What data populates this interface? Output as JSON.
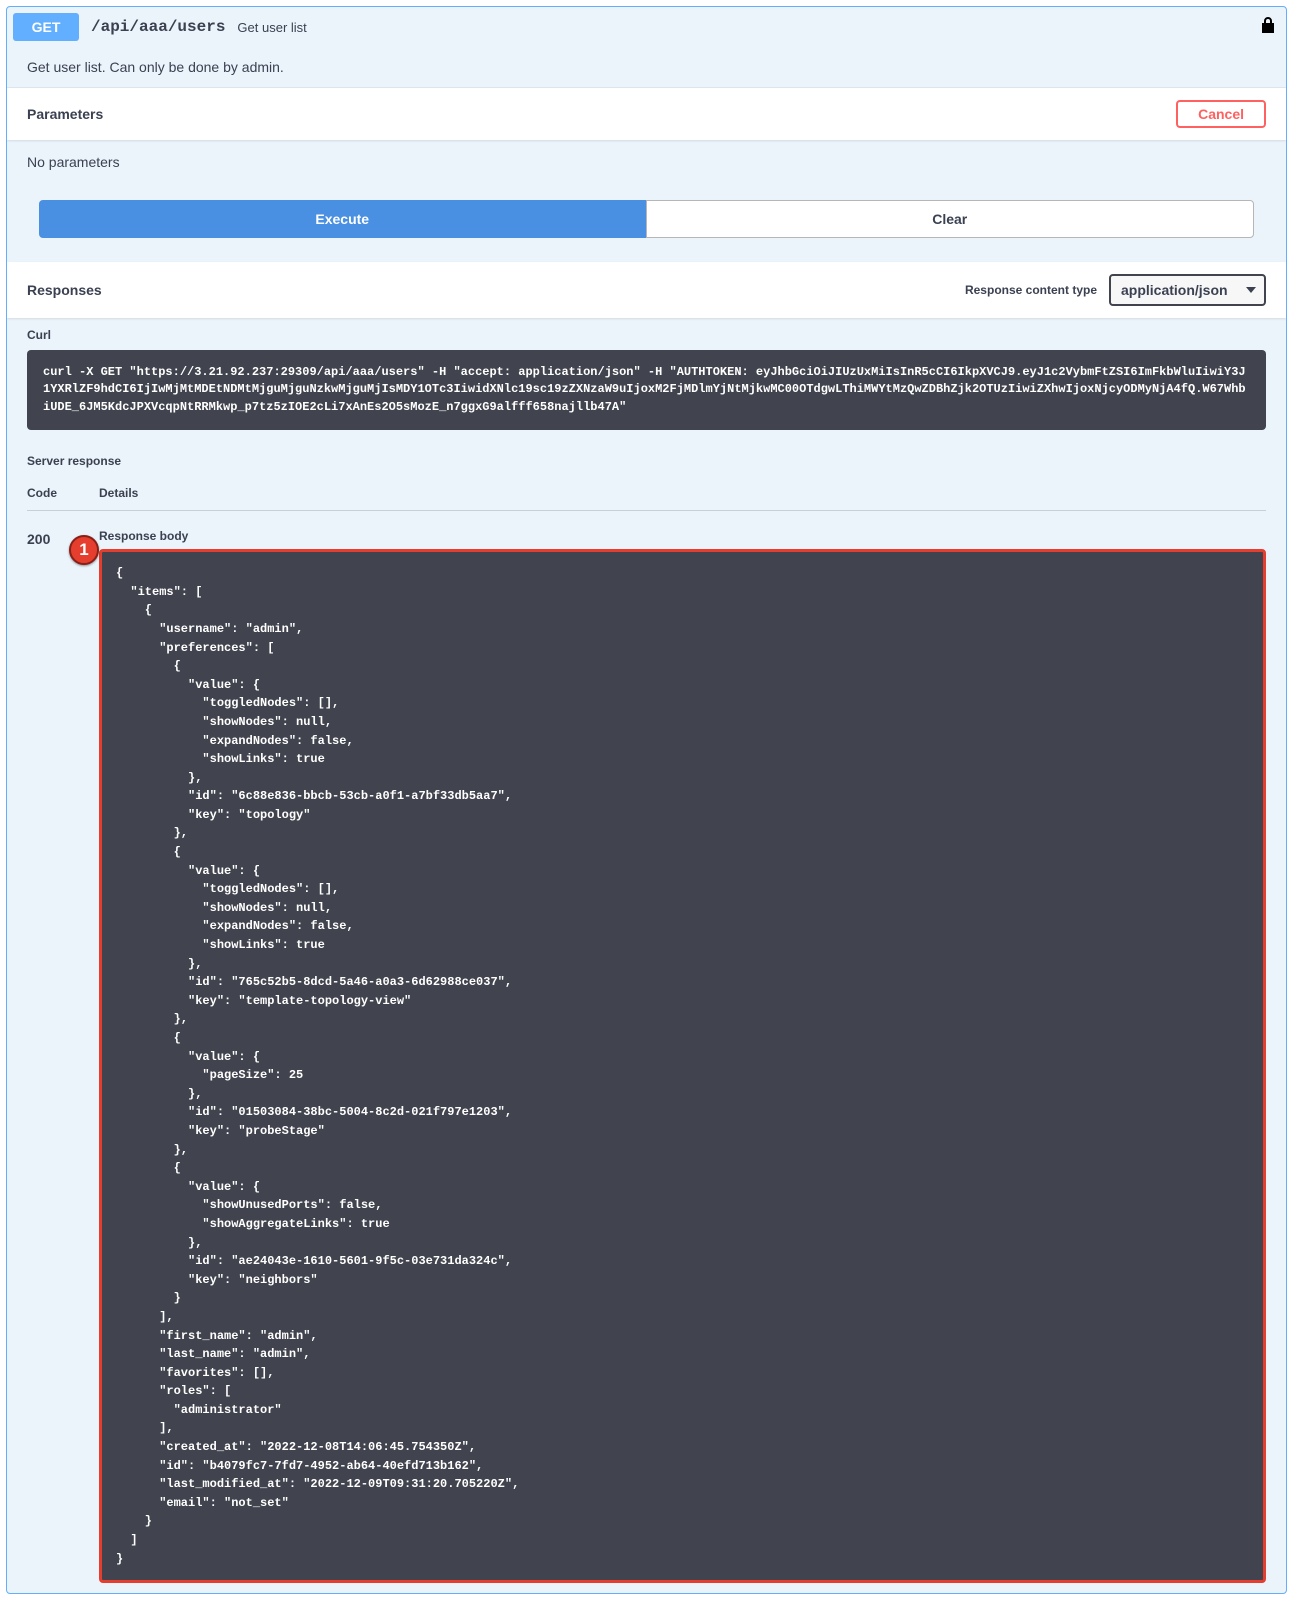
{
  "endpoint": {
    "method": "GET",
    "path": "/api/aaa/users",
    "summary": "Get user list",
    "description": "Get user list. Can only be done by admin."
  },
  "parameters": {
    "title": "Parameters",
    "cancel_label": "Cancel",
    "no_params": "No parameters",
    "execute_label": "Execute",
    "clear_label": "Clear"
  },
  "responses": {
    "title": "Responses",
    "content_type_label": "Response content type",
    "content_type_value": "application/json"
  },
  "curl": {
    "label": "Curl",
    "command": "curl -X GET \"https://3.21.92.237:29309/api/aaa/users\" -H \"accept: application/json\" -H \"AUTHTOKEN: eyJhbGciOiJIUzUxMiIsInR5cCI6IkpXVCJ9.eyJ1c2VybmFtZSI6ImFkbWluIiwiY3J1YXRlZF9hdCI6IjIwMjMtMDEtNDMtMjguMjguNzkwMjguMjIsMDY1OTc3IiwidXNlc19sc19zZXNzaW9uIjoxM2FjMDlmYjNtMjkwMC00OTdgwLThiMWYtMzQwZDBhZjk2OTUzIiwiZXhwIjoxNjcyODMyNjA4fQ.W67WhbiUDE_6JM5KdcJPXVcqpNtRRMkwp_p7tz5zIOE2cLi7xAnEs2O5sMozE_n7ggxG9alfff658najllb47A\""
  },
  "server_response": {
    "label": "Server response",
    "code_header": "Code",
    "details_header": "Details",
    "code": "200",
    "body_label": "Response body",
    "marker": "1",
    "body": "{\n  \"items\": [\n    {\n      \"username\": \"admin\",\n      \"preferences\": [\n        {\n          \"value\": {\n            \"toggledNodes\": [],\n            \"showNodes\": null,\n            \"expandNodes\": false,\n            \"showLinks\": true\n          },\n          \"id\": \"6c88e836-bbcb-53cb-a0f1-a7bf33db5aa7\",\n          \"key\": \"topology\"\n        },\n        {\n          \"value\": {\n            \"toggledNodes\": [],\n            \"showNodes\": null,\n            \"expandNodes\": false,\n            \"showLinks\": true\n          },\n          \"id\": \"765c52b5-8dcd-5a46-a0a3-6d62988ce037\",\n          \"key\": \"template-topology-view\"\n        },\n        {\n          \"value\": {\n            \"pageSize\": 25\n          },\n          \"id\": \"01503084-38bc-5004-8c2d-021f797e1203\",\n          \"key\": \"probeStage\"\n        },\n        {\n          \"value\": {\n            \"showUnusedPorts\": false,\n            \"showAggregateLinks\": true\n          },\n          \"id\": \"ae24043e-1610-5601-9f5c-03e731da324c\",\n          \"key\": \"neighbors\"\n        }\n      ],\n      \"first_name\": \"admin\",\n      \"last_name\": \"admin\",\n      \"favorites\": [],\n      \"roles\": [\n        \"administrator\"\n      ],\n      \"created_at\": \"2022-12-08T14:06:45.754350Z\",\n      \"id\": \"b4079fc7-7fd7-4952-ab64-40efd713b162\",\n      \"last_modified_at\": \"2022-12-09T09:31:20.705220Z\",\n      \"email\": \"not_set\"\n    }\n  ]\n}"
  }
}
